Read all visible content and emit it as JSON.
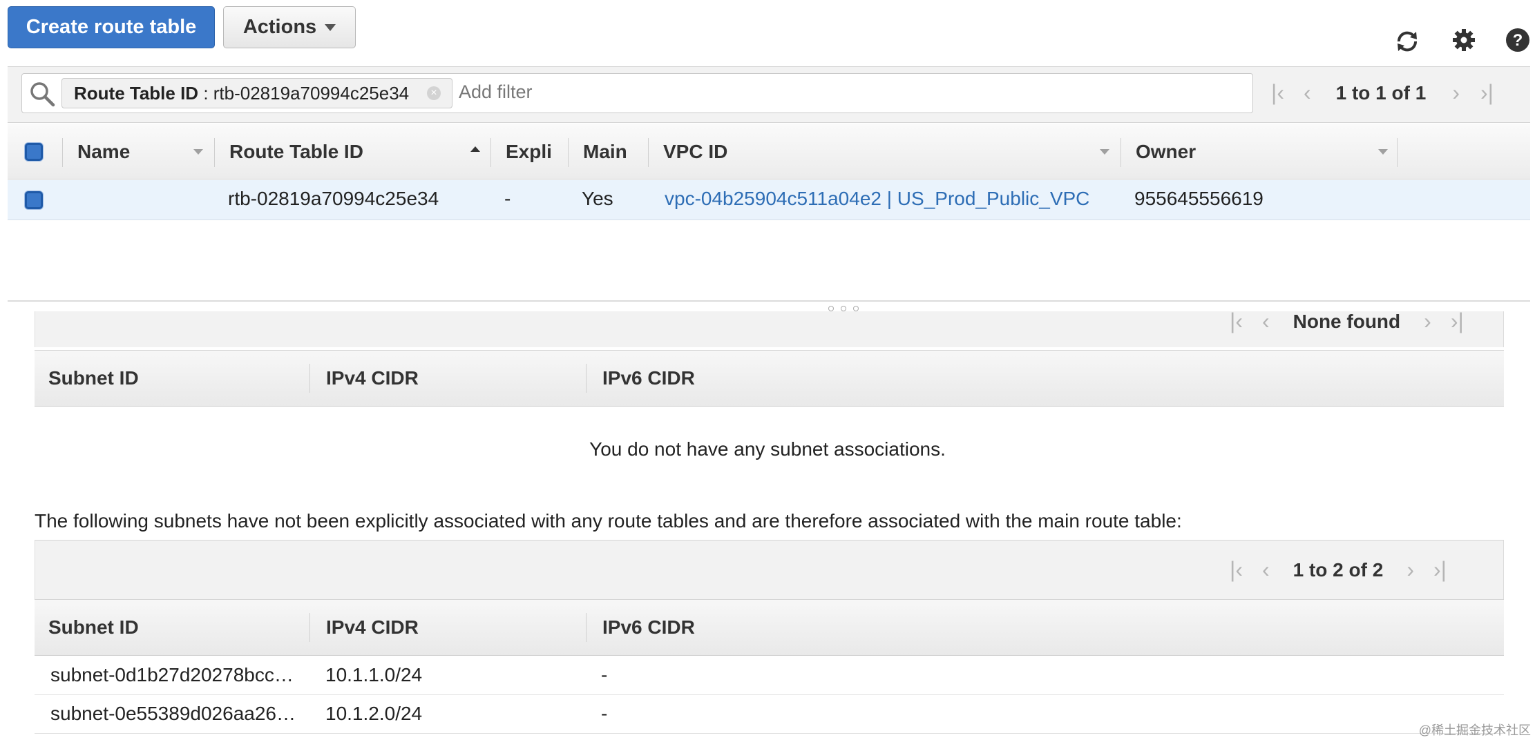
{
  "toolbar": {
    "create_label": "Create route table",
    "actions_label": "Actions",
    "icons": [
      "refresh-icon",
      "settings-gear-icon",
      "help-icon"
    ]
  },
  "filter": {
    "token_key": "Route Table ID",
    "token_sep": " : ",
    "token_value": "rtb-02819a70994c25e34",
    "placeholder": "Add filter"
  },
  "top_pager": {
    "text": "1 to 1 of 1"
  },
  "route_tables": {
    "columns": [
      "Name",
      "Route Table ID",
      "Expli",
      "Main",
      "VPC ID",
      "Owner"
    ],
    "rows": [
      {
        "name": "",
        "route_table_id": "rtb-02819a70994c25e34",
        "explicit": "-",
        "main": "Yes",
        "vpc_id": "vpc-04b25904c511a04e2 | US_Prod_Public_VPC",
        "owner": "955645556619"
      }
    ]
  },
  "explicit_assoc": {
    "pager_text": "None found",
    "columns": [
      "Subnet ID",
      "IPv4 CIDR",
      "IPv6 CIDR"
    ],
    "empty_message": "You do not have any subnet associations."
  },
  "main_assoc": {
    "note": "The following subnets have not been explicitly associated with any route tables and are therefore associated with the main route table:",
    "pager_text": "1 to 2 of 2",
    "columns": [
      "Subnet ID",
      "IPv4 CIDR",
      "IPv6 CIDR"
    ],
    "rows": [
      {
        "subnet_id": "subnet-0d1b27d20278bcc…",
        "ipv4": "10.1.1.0/24",
        "ipv6": "-"
      },
      {
        "subnet_id": "subnet-0e55389d026aa26…",
        "ipv4": "10.1.2.0/24",
        "ipv6": "-"
      }
    ]
  },
  "watermark": "@稀土掘金技术社区",
  "colors": {
    "primary": "#3b78c9",
    "link": "#2d6db5",
    "selected_row": "#eaf3fc"
  }
}
